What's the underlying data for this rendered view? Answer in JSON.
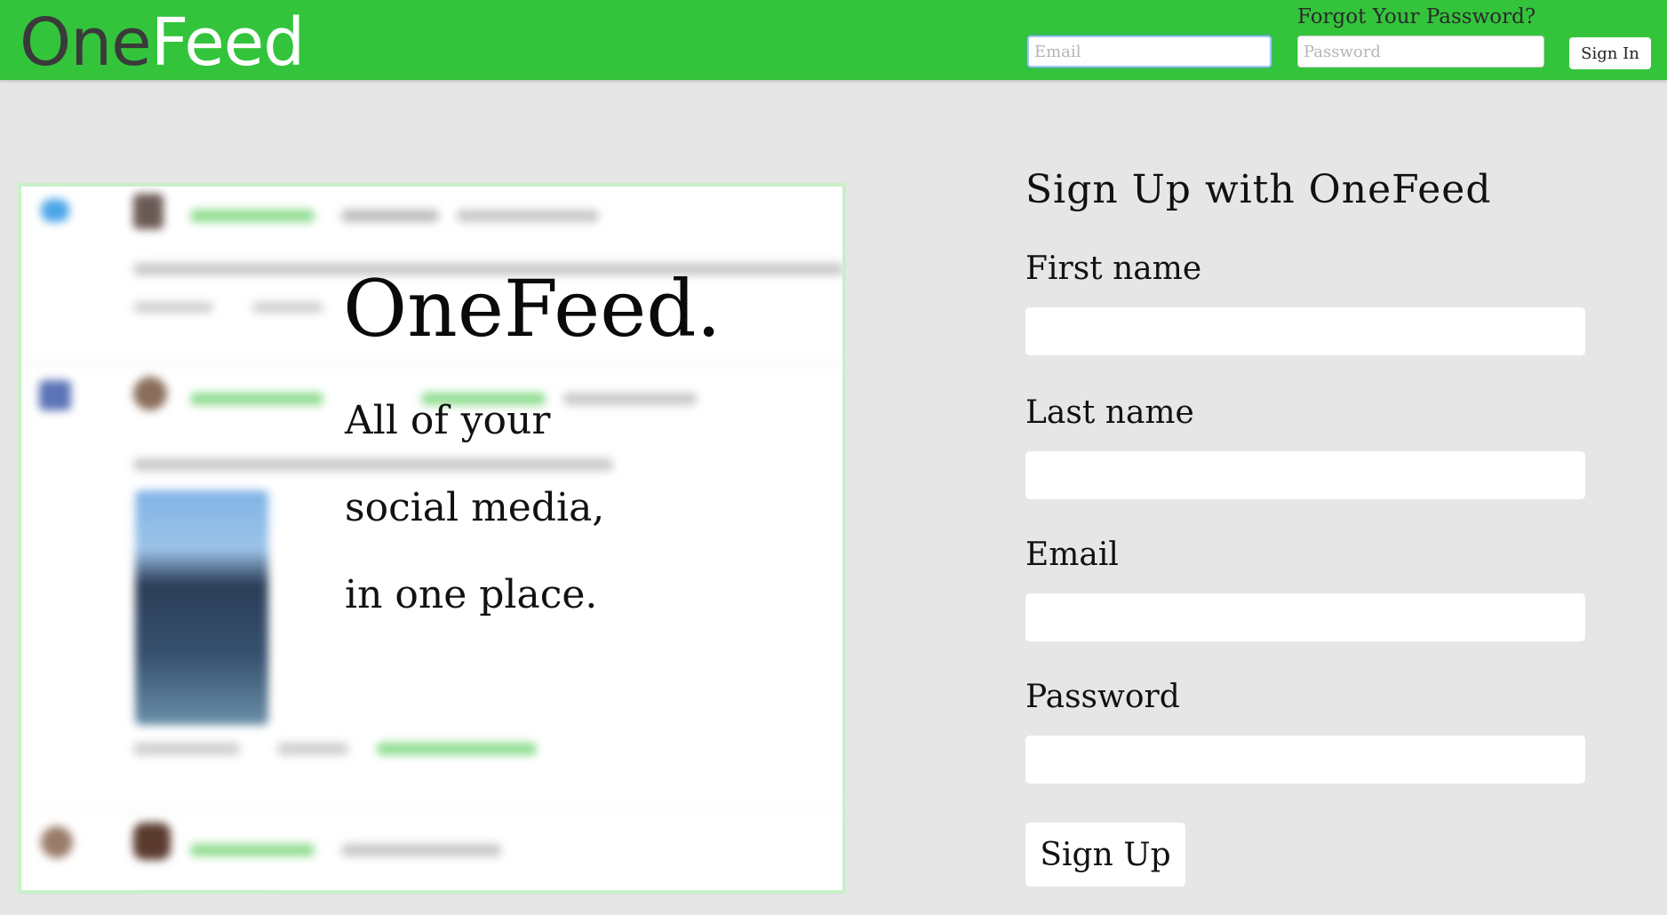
{
  "header": {
    "logo_one": "One",
    "logo_feed": "Feed",
    "email_placeholder": "Email",
    "password_placeholder": "Password",
    "forgot_password": "Forgot Your Password?",
    "sign_in": "Sign In"
  },
  "hero": {
    "title": "OneFeed.",
    "tagline": [
      "All of your",
      "social media,",
      "in one place."
    ]
  },
  "signup": {
    "title": "Sign Up with OneFeed",
    "fields": [
      {
        "label": "First name"
      },
      {
        "label": "Last name"
      },
      {
        "label": "Email"
      },
      {
        "label": "Password"
      }
    ],
    "submit": "Sign Up"
  },
  "colors": {
    "brand_green": "#33c43c",
    "page_bg": "#e6e6e6"
  },
  "icons": [
    "twitter-icon",
    "facebook-icon",
    "instagram-icon"
  ]
}
